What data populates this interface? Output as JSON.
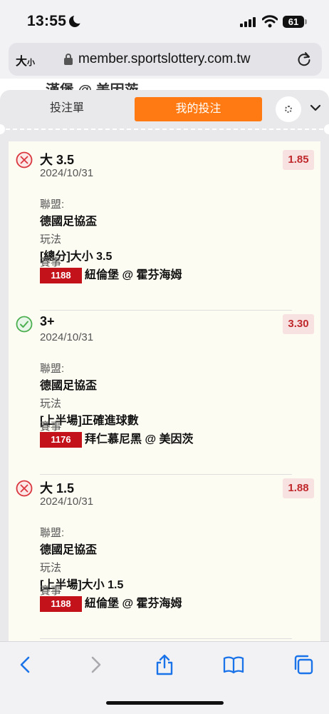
{
  "status_bar": {
    "time": "13:55",
    "battery": "61",
    "icons": [
      "moon-icon",
      "signal-icon",
      "wifi-icon",
      "battery-icon"
    ]
  },
  "browser": {
    "text_size_label": "大",
    "text_size_small": "小",
    "url": "member.sportslottery.com.tw",
    "icons": [
      "lock-icon",
      "reload-icon"
    ]
  },
  "page": {
    "peek_title": "漢堡 @ 美因茨",
    "tabs": {
      "bet_slip": "投注單",
      "my_bets": "我的投注"
    },
    "colors": {
      "active_tab": "#ff7a12",
      "odds_text": "#c0292c",
      "event_code_bg": "#c3121a",
      "lost": "#d9363e",
      "won": "#4caf50"
    },
    "labels": {
      "league": "聯盟:",
      "play": "玩法",
      "event": "賽事"
    },
    "bets": [
      {
        "status": "lost",
        "pick": "大 3.5",
        "odds": "1.85",
        "date": "2024/10/31",
        "league": "德國足協盃",
        "play": "[總分]大小 3.5",
        "event_code": "1188",
        "event_name": "紐倫堡 @ 霍芬海姆"
      },
      {
        "status": "won",
        "pick": "3+",
        "odds": "3.30",
        "date": "2024/10/31",
        "league": "德國足協盃",
        "play": "[上半場]正確進球數",
        "event_code": "1176",
        "event_name": "拜仁慕尼黑 @ 美因茨"
      },
      {
        "status": "lost",
        "pick": "大 1.5",
        "odds": "1.88",
        "date": "2024/10/31",
        "league": "德國足協盃",
        "play": "[上半場]大小 1.5",
        "event_code": "1188",
        "event_name": "紐倫堡 @ 霍芬海姆"
      }
    ]
  },
  "toolbar": {
    "icons": [
      "back-icon",
      "forward-icon",
      "share-icon",
      "bookmarks-icon",
      "tabs-icon"
    ]
  }
}
